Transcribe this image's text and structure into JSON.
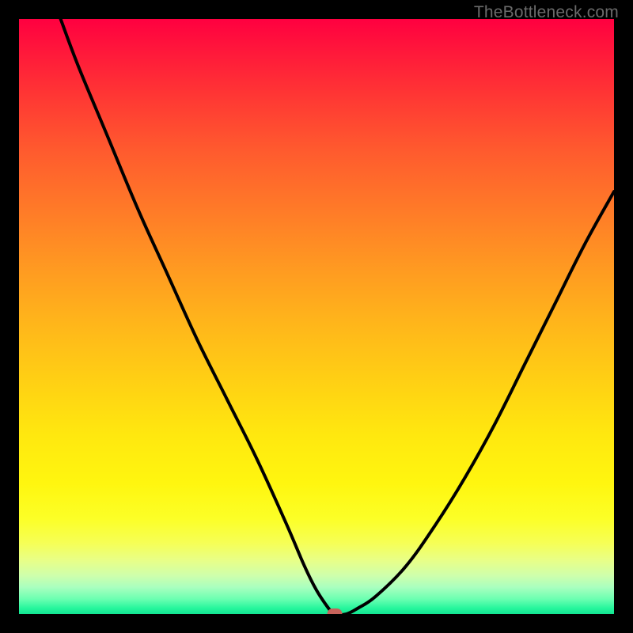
{
  "watermark": "TheBottleneck.com",
  "colors": {
    "frame_bg": "#000000",
    "curve_stroke": "#000000",
    "marker_fill": "#c7635b",
    "gradient_top": "#ff0040",
    "gradient_mid": "#ffe80f",
    "gradient_bottom": "#12e592"
  },
  "chart_data": {
    "type": "line",
    "title": "",
    "xlabel": "",
    "ylabel": "",
    "xlim": [
      0,
      100
    ],
    "ylim": [
      0,
      100
    ],
    "grid": false,
    "legend": false,
    "description": "V-shaped bottleneck curve. Higher y = worse (red); minimum near x≈53 at y≈0 (green). Color gradient encodes y from green (0, bottom) to red (100, top).",
    "series": [
      {
        "name": "bottleneck-curve",
        "x": [
          7,
          10,
          15,
          20,
          25,
          30,
          35,
          40,
          45,
          48,
          50,
          52,
          53,
          55,
          57,
          60,
          65,
          70,
          75,
          80,
          85,
          90,
          95,
          100
        ],
        "y": [
          100,
          92,
          80,
          68,
          57,
          46,
          36,
          26,
          15,
          8,
          4,
          1,
          0,
          0,
          1,
          3,
          8,
          15,
          23,
          32,
          42,
          52,
          62,
          71
        ]
      }
    ],
    "marker": {
      "x": 53,
      "y": 0
    },
    "color_scale": {
      "axis": "y",
      "stops": [
        {
          "value": 0,
          "color": "#12e592"
        },
        {
          "value": 20,
          "color": "#fcff27"
        },
        {
          "value": 50,
          "color": "#ffb81a"
        },
        {
          "value": 80,
          "color": "#ff5a2e"
        },
        {
          "value": 100,
          "color": "#ff0040"
        }
      ]
    }
  }
}
